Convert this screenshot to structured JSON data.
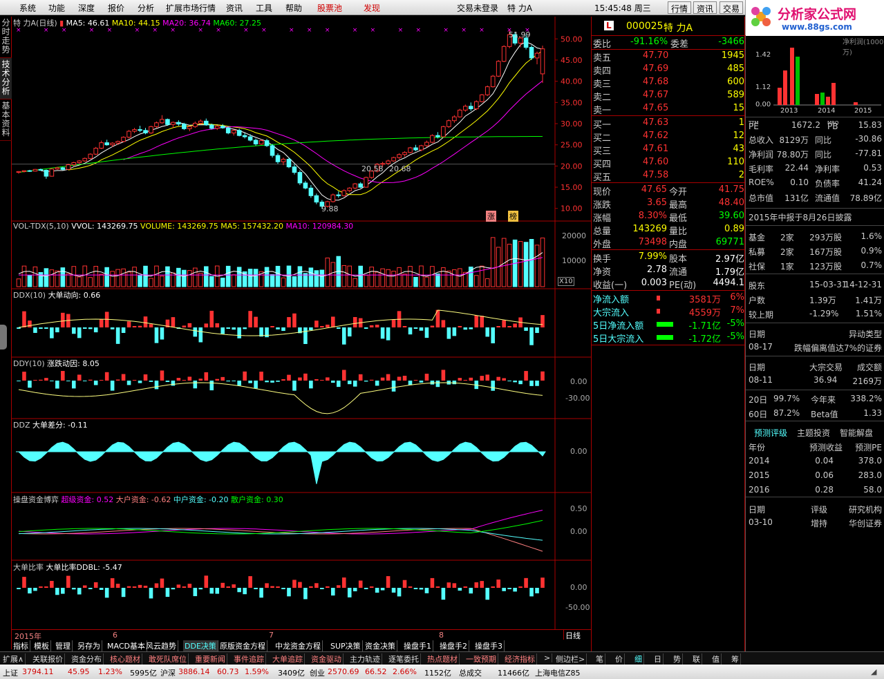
{
  "menu": {
    "items": [
      "系统",
      "功能",
      "深度",
      "报价",
      "分析",
      "扩展市场行情",
      "资讯",
      "工具",
      "帮助"
    ],
    "stock_pool": "股票池",
    "discover": "发现",
    "login": "交易未登录",
    "stock_short": "特  力A",
    "time": "15:45:48 周三",
    "btn_quote": "行情",
    "btn_news": "资讯",
    "btn_trade": "交易"
  },
  "logo": {
    "title": "分析家公式网",
    "url": "www.88gs.com"
  },
  "left_tabs": [
    "分时走势",
    "技术分析",
    "基本资料"
  ],
  "kline": {
    "title": "特  力A(日线)",
    "ma5": "MA5: 46.61",
    "ma10": "MA10: 44.15",
    "ma20": "MA20: 36.74",
    "ma60": "MA60: 27.25",
    "high_mark": "51.99",
    "low_mark": "9.88",
    "mid_mark1": "20.58",
    "mid_mark2": "20.68",
    "tag_up": "涨",
    "tag_list": "榜",
    "axis": [
      "50.00",
      "45.00",
      "40.00",
      "35.00",
      "30.00",
      "25.00",
      "20.00",
      "15.00",
      "10.00"
    ],
    "colors": {
      "up": "#ff3232",
      "down": "#54ffff",
      "ma5": "#ffffff",
      "ma10": "#ffff00",
      "ma20": "#ff00ff",
      "ma60": "#00ff00"
    }
  },
  "vol": {
    "title": "VOL-TDX(5,10)",
    "vvol": "VVOL: 143269.75",
    "volume": "VOLUME: 143269.75",
    "ma5": "MA5: 157432.20",
    "ma10": "MA10: 120984.30",
    "axis": [
      "20000",
      "10000"
    ],
    "x10": "X10"
  },
  "ddx": {
    "title": "DDX(10)",
    "label": "大单动向: 0.66"
  },
  "ddy": {
    "title": "DDY(10)",
    "label": "涨跌动因: 8.05",
    "axis": [
      "0.00",
      "-30.00"
    ]
  },
  "ddz": {
    "title": "DDZ",
    "label": "大单差分: -0.11",
    "axis": [
      "0.00"
    ]
  },
  "czb": {
    "title": "操盘资金博弈",
    "super": "超级资金: 0.52",
    "big": "大户资金: -0.62",
    "mid": "中户资金: -0.20",
    "small": "散户资金: 0.30",
    "axis": [
      "0.50",
      "0.00"
    ]
  },
  "ddbl": {
    "title": "大单比率",
    "label": "大单比率DDBL: -5.47",
    "axis": [
      "0.00",
      "-50.00"
    ]
  },
  "dates": {
    "y": "2015年",
    "m6": "6",
    "m7": "7",
    "m8": "8",
    "cycle": "日线"
  },
  "bottom_tabs": [
    "指标",
    "模板",
    "管理",
    "另存为",
    "MACD基本",
    "风云趋势",
    "DDE决策",
    "原版资金方程",
    "中龙资金方程",
    "SUP决策",
    "资金决策",
    "操盘手1",
    "操盘手2",
    "操盘手3"
  ],
  "ext_tabs": [
    "扩展∧",
    "关联报价",
    "资金分布",
    "核心题材",
    "敢死队席位",
    "重要新闻",
    "事件追踪",
    "大单追踪",
    "资金驱动",
    "主力轨迹",
    "逐笔委托",
    "热点题材",
    "一致预期",
    "经济指标",
    ">",
    "侧边栏>",
    "笔",
    "价",
    "细",
    "日",
    "势",
    "联",
    "值",
    "筹"
  ],
  "quote": {
    "code": "000025",
    "name": "特  力A",
    "badge": "L",
    "wb_label": "委比",
    "wb": "-91.16%",
    "wc_label": "委差",
    "wc": "-3466",
    "sells": [
      {
        "l": "卖五",
        "p": "47.70",
        "v": "1945"
      },
      {
        "l": "卖四",
        "p": "47.69",
        "v": "485"
      },
      {
        "l": "卖三",
        "p": "47.68",
        "v": "600"
      },
      {
        "l": "卖二",
        "p": "47.67",
        "v": "589"
      },
      {
        "l": "卖一",
        "p": "47.65",
        "v": "15"
      }
    ],
    "buys": [
      {
        "l": "买一",
        "p": "47.63",
        "v": "1"
      },
      {
        "l": "买二",
        "p": "47.62",
        "v": "12"
      },
      {
        "l": "买三",
        "p": "47.61",
        "v": "43"
      },
      {
        "l": "买四",
        "p": "47.60",
        "v": "110"
      },
      {
        "l": "买五",
        "p": "47.58",
        "v": "2"
      }
    ],
    "stats": [
      {
        "a": "现价",
        "av": "47.65",
        "b": "今开",
        "bv": "41.75"
      },
      {
        "a": "涨跌",
        "av": "3.65",
        "b": "最高",
        "bv": "48.40"
      },
      {
        "a": "涨幅",
        "av": "8.30%",
        "b": "最低",
        "bv": "39.60"
      },
      {
        "a": "总量",
        "av": "143269",
        "b": "量比",
        "bv": "0.89"
      },
      {
        "a": "外盘",
        "av": "73498",
        "b": "内盘",
        "bv": "69771"
      }
    ],
    "stats2": [
      {
        "a": "换手",
        "av": "7.99%",
        "b": "股本",
        "bv": "2.97亿"
      },
      {
        "a": "净资",
        "av": "2.78",
        "b": "流通",
        "bv": "1.79亿"
      },
      {
        "a": "收益(一)",
        "av": "0.003",
        "b": "PE(动)",
        "bv": "4494.1"
      }
    ],
    "flows": [
      {
        "l": "净流入额",
        "v": "3581万",
        "p": "6%"
      },
      {
        "l": "大宗流入",
        "v": "4559万",
        "p": "7%"
      },
      {
        "l": "5日净流入额",
        "v": "-1.71亿",
        "p": "-5%"
      },
      {
        "l": "5日大宗流入",
        "v": "-1.72亿",
        "p": "-5%"
      }
    ]
  },
  "f10": {
    "chart_label": "净利润(1000万)",
    "years": [
      "2013",
      "2014",
      "2015"
    ],
    "yaxis": [
      "1.42",
      "1.12",
      "0.00"
    ],
    "pe_label": "PE",
    "pe_sup": "TTM",
    "pe": "1672.2",
    "pb_label": "PB",
    "pb_sup": "MRQ",
    "pb": "15.83",
    "rows1": [
      {
        "a": "总收入",
        "av": "8129万",
        "b": "同比",
        "bv": "-30.86"
      },
      {
        "a": "净利润",
        "av": "78.80万",
        "b": "同比",
        "bv": "-77.81"
      },
      {
        "a": "毛利率",
        "av": "22.44",
        "b": "净利率",
        "bv": "0.53"
      },
      {
        "a": "ROE%",
        "av": "0.10",
        "b": "负债率",
        "bv": "41.24"
      },
      {
        "a": "总市值",
        "av": "131亿",
        "b": "流通值",
        "bv": "78.89亿"
      }
    ],
    "notice": "2015年中报于8月26日披露",
    "holders": [
      {
        "t": "基金",
        "n": "2家",
        "s": "293万股",
        "p": "1.6%"
      },
      {
        "t": "私募",
        "n": "2家",
        "s": "167万股",
        "p": "0.9%"
      },
      {
        "t": "社保",
        "n": "1家",
        "s": "123万股",
        "p": "0.7%"
      }
    ],
    "sh_head": [
      "股东",
      "15-03-31",
      "14-12-31"
    ],
    "sh_rows": [
      [
        "户数",
        "1.39万",
        "1.41万"
      ],
      [
        "较上期",
        "-1.29%",
        "1.51%"
      ]
    ],
    "abn_head": [
      "日期",
      "异动类型"
    ],
    "abn_row": [
      "08-17",
      "跌幅偏离值达7%的证券"
    ],
    "blk_head": [
      "日期",
      "大宗交易",
      "成交额"
    ],
    "blk_row": [
      "08-11",
      "36.94",
      "2169万"
    ],
    "perf": [
      [
        "20日",
        "99.7%",
        "今年来",
        "338.2%"
      ],
      [
        "60日",
        "87.2%",
        "Beta值",
        "1.33"
      ]
    ],
    "fc_tabs": [
      "预测评级",
      "主题投资",
      "智能解盘"
    ],
    "fc_head": [
      "年份",
      "预测收益",
      "预测PE"
    ],
    "fc_rows": [
      [
        "2014",
        "0.04",
        "378.0"
      ],
      [
        "2015",
        "0.06",
        "283.0"
      ],
      [
        "2016",
        "0.28",
        "58.0"
      ]
    ],
    "rt_head": [
      "日期",
      "评级",
      "研究机构"
    ],
    "rt_row": [
      "03-10",
      "增持",
      "华创证券"
    ]
  },
  "status": {
    "sh_label": "上证",
    "sh": "3794.11",
    "sh_chg": "45.95",
    "sh_pct": "1.23%",
    "sh_amt": "5995亿",
    "hs_label": "沪深",
    "hs": "3886.14",
    "hs_chg": "60.73",
    "hs_pct": "1.59%",
    "hs_amt": "3409亿",
    "cy_label": "创业",
    "cy": "2570.69",
    "cy_chg": "66.52",
    "cy_pct": "2.66%",
    "cy_amt": "1152亿",
    "deal_label": "总成交",
    "deal": "11466亿",
    "server": "上海电信Z85"
  },
  "chart_data": {
    "type": "candlestick",
    "ylim": [
      8,
      52
    ],
    "candles": [
      [
        18.5,
        18.8,
        18.2,
        18.7
      ],
      [
        18.7,
        19.0,
        18.5,
        18.9
      ],
      [
        18.9,
        19.1,
        18.6,
        18.8
      ],
      [
        18.8,
        19.3,
        18.7,
        19.2
      ],
      [
        19.2,
        19.4,
        18.9,
        19.0
      ],
      [
        19.0,
        19.2,
        17.0,
        17.6
      ],
      [
        17.6,
        19.5,
        17.5,
        19.3
      ],
      [
        19.3,
        19.8,
        19.1,
        19.6
      ],
      [
        19.6,
        19.8,
        19.0,
        19.2
      ],
      [
        19.2,
        20.5,
        19.1,
        20.3
      ],
      [
        20.3,
        21.0,
        20.0,
        20.8
      ],
      [
        20.8,
        21.4,
        20.5,
        21.2
      ],
      [
        21.2,
        22.0,
        21.0,
        21.8
      ],
      [
        21.8,
        23.0,
        21.6,
        22.8
      ],
      [
        22.8,
        24.5,
        22.6,
        24.2
      ],
      [
        24.2,
        26.0,
        24.0,
        25.5
      ],
      [
        25.5,
        26.2,
        24.8,
        25.0
      ],
      [
        25.0,
        25.6,
        24.5,
        25.4
      ],
      [
        25.4,
        26.0,
        25.0,
        25.8
      ],
      [
        25.8,
        27.0,
        25.6,
        26.8
      ],
      [
        26.8,
        28.5,
        26.5,
        28.2
      ],
      [
        28.2,
        29.0,
        27.8,
        28.6
      ],
      [
        28.6,
        29.5,
        28.0,
        28.4
      ],
      [
        28.4,
        29.0,
        27.5,
        27.8
      ],
      [
        27.8,
        29.5,
        27.6,
        29.3
      ],
      [
        29.3,
        30.5,
        29.0,
        30.2
      ],
      [
        30.2,
        32.0,
        30.0,
        31.0
      ],
      [
        31.0,
        31.2,
        29.5,
        29.8
      ],
      [
        29.8,
        30.5,
        29.0,
        30.3
      ],
      [
        30.3,
        30.8,
        29.5,
        29.9
      ],
      [
        29.9,
        30.2,
        28.5,
        28.8
      ],
      [
        28.8,
        29.5,
        28.2,
        29.3
      ],
      [
        29.3,
        30.5,
        29.0,
        30.1
      ],
      [
        30.1,
        31.0,
        29.8,
        30.6
      ],
      [
        30.6,
        31.2,
        29.5,
        29.7
      ],
      [
        29.7,
        30.0,
        28.6,
        28.9
      ],
      [
        28.9,
        29.6,
        28.5,
        29.4
      ],
      [
        29.4,
        29.9,
        28.8,
        29.0
      ],
      [
        29.0,
        29.3,
        27.5,
        27.8
      ],
      [
        27.8,
        28.6,
        27.2,
        28.4
      ],
      [
        28.4,
        28.8,
        27.0,
        27.2
      ],
      [
        27.2,
        27.8,
        26.5,
        26.9
      ],
      [
        26.9,
        27.5,
        25.8,
        26.1
      ],
      [
        26.1,
        26.5,
        24.8,
        25.2
      ],
      [
        25.2,
        26.3,
        25.0,
        26.0
      ],
      [
        26.0,
        26.4,
        24.5,
        24.8
      ],
      [
        24.8,
        25.2,
        22.0,
        22.5
      ],
      [
        22.5,
        23.0,
        20.5,
        21.0
      ],
      [
        21.0,
        22.0,
        20.2,
        21.6
      ],
      [
        21.6,
        22.0,
        19.5,
        19.8
      ],
      [
        19.8,
        20.5,
        18.0,
        18.5
      ],
      [
        18.5,
        19.0,
        15.5,
        16.0
      ],
      [
        16.0,
        16.5,
        14.5,
        14.8
      ],
      [
        14.8,
        15.5,
        12.5,
        13.0
      ],
      [
        13.0,
        13.5,
        11.0,
        11.5
      ],
      [
        11.5,
        12.0,
        9.88,
        10.5
      ],
      [
        10.5,
        11.8,
        10.2,
        11.6
      ],
      [
        11.6,
        13.5,
        11.4,
        13.2
      ],
      [
        13.2,
        14.0,
        12.5,
        13.0
      ],
      [
        13.0,
        14.5,
        12.8,
        14.2
      ],
      [
        14.2,
        15.0,
        13.8,
        14.8
      ],
      [
        14.8,
        16.0,
        14.5,
        15.8
      ],
      [
        15.8,
        16.2,
        14.8,
        15.0
      ],
      [
        15.0,
        17.5,
        14.9,
        17.3
      ],
      [
        17.3,
        19.0,
        17.0,
        18.8
      ],
      [
        18.8,
        20.7,
        18.5,
        20.4
      ],
      [
        20.4,
        21.0,
        19.8,
        20.6
      ],
      [
        20.6,
        21.5,
        20.2,
        21.2
      ],
      [
        21.2,
        22.2,
        21.0,
        22.0
      ],
      [
        22.0,
        23.0,
        21.6,
        22.7
      ],
      [
        22.7,
        23.5,
        22.2,
        23.2
      ],
      [
        23.2,
        24.5,
        23.0,
        24.3
      ],
      [
        24.3,
        25.0,
        23.5,
        23.8
      ],
      [
        23.8,
        25.0,
        23.5,
        24.8
      ],
      [
        24.8,
        26.0,
        24.5,
        25.6
      ],
      [
        25.6,
        27.5,
        25.4,
        27.2
      ],
      [
        27.2,
        28.0,
        26.5,
        26.9
      ],
      [
        26.9,
        29.5,
        26.8,
        29.3
      ],
      [
        29.3,
        31.0,
        29.0,
        30.7
      ],
      [
        30.7,
        32.0,
        30.2,
        31.6
      ],
      [
        31.6,
        33.5,
        31.4,
        33.2
      ],
      [
        33.2,
        34.5,
        32.8,
        34.1
      ],
      [
        34.1,
        35.0,
        33.0,
        33.5
      ],
      [
        33.5,
        35.5,
        33.2,
        35.2
      ],
      [
        35.2,
        37.0,
        35.0,
        36.8
      ],
      [
        36.8,
        39.0,
        36.5,
        38.7
      ],
      [
        38.7,
        41.5,
        38.5,
        41.2
      ],
      [
        41.2,
        45.0,
        41.0,
        44.7
      ],
      [
        44.7,
        48.5,
        44.5,
        48.2
      ],
      [
        48.2,
        51.99,
        47.8,
        51.0
      ],
      [
        51.0,
        51.5,
        48.5,
        49.0
      ],
      [
        49.0,
        50.5,
        48.0,
        50.2
      ],
      [
        50.2,
        51.0,
        47.5,
        48.0
      ],
      [
        48.0,
        48.5,
        45.0,
        45.5
      ],
      [
        45.5,
        47.0,
        44.0,
        46.6
      ],
      [
        41.75,
        48.4,
        39.6,
        47.65
      ]
    ]
  }
}
